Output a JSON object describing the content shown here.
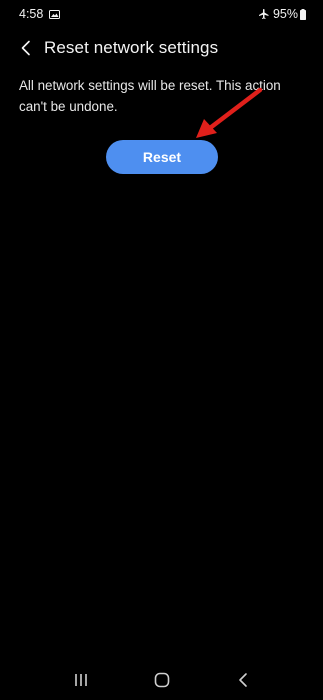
{
  "status_bar": {
    "time": "4:58",
    "battery": "95%",
    "icons": [
      "gallery-icon",
      "airplane-mode-icon",
      "battery-icon"
    ]
  },
  "header": {
    "back_icon": "chevron-left-icon",
    "title": "Reset network settings"
  },
  "main": {
    "description": "All network settings will be reset. This action can't be undone.",
    "reset_label": "Reset"
  },
  "annotation": {
    "icon": "red-arrow",
    "color": "#e0201b"
  },
  "nav_bar": {
    "items": [
      "recent-apps-icon",
      "home-icon",
      "back-icon"
    ]
  },
  "colors": {
    "background": "#000000",
    "accent": "#4e8ff0",
    "text": "#ffffff"
  }
}
